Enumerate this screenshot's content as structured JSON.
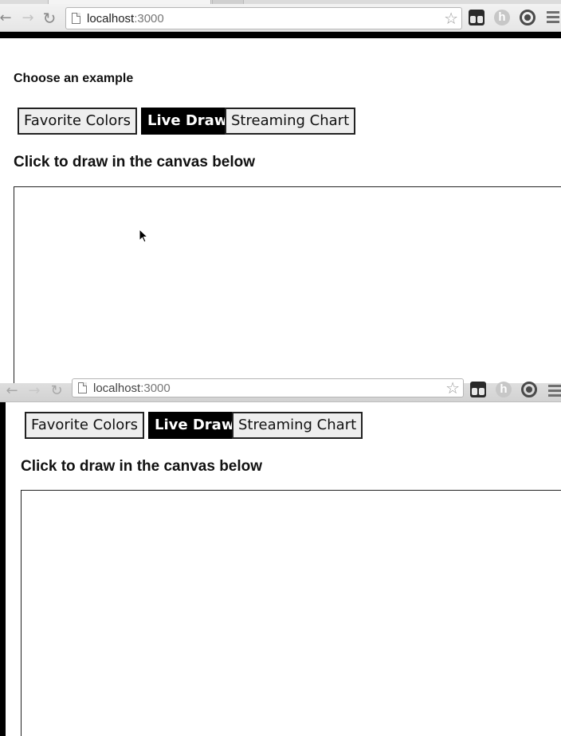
{
  "browser": {
    "url_host": "localhost",
    "url_port": ":3000"
  },
  "page": {
    "choose_heading": "Choose an example",
    "buttons": {
      "favorite_colors": "Favorite Colors",
      "live_draw": "Live Draw",
      "streaming_chart": "Streaming Chart"
    },
    "active_example": "Live Draw",
    "instruction": "Click to draw in the canvas below"
  },
  "icons": {
    "back": "back-arrow-icon",
    "forward": "forward-arrow-icon",
    "reload": "reload-icon",
    "page": "page-icon",
    "bookmark": "star-icon",
    "menu": "menu-icon"
  },
  "colors": {
    "active_button_bg": "#000000",
    "active_button_text": "#ffffff",
    "button_bg": "#eeeeee"
  }
}
